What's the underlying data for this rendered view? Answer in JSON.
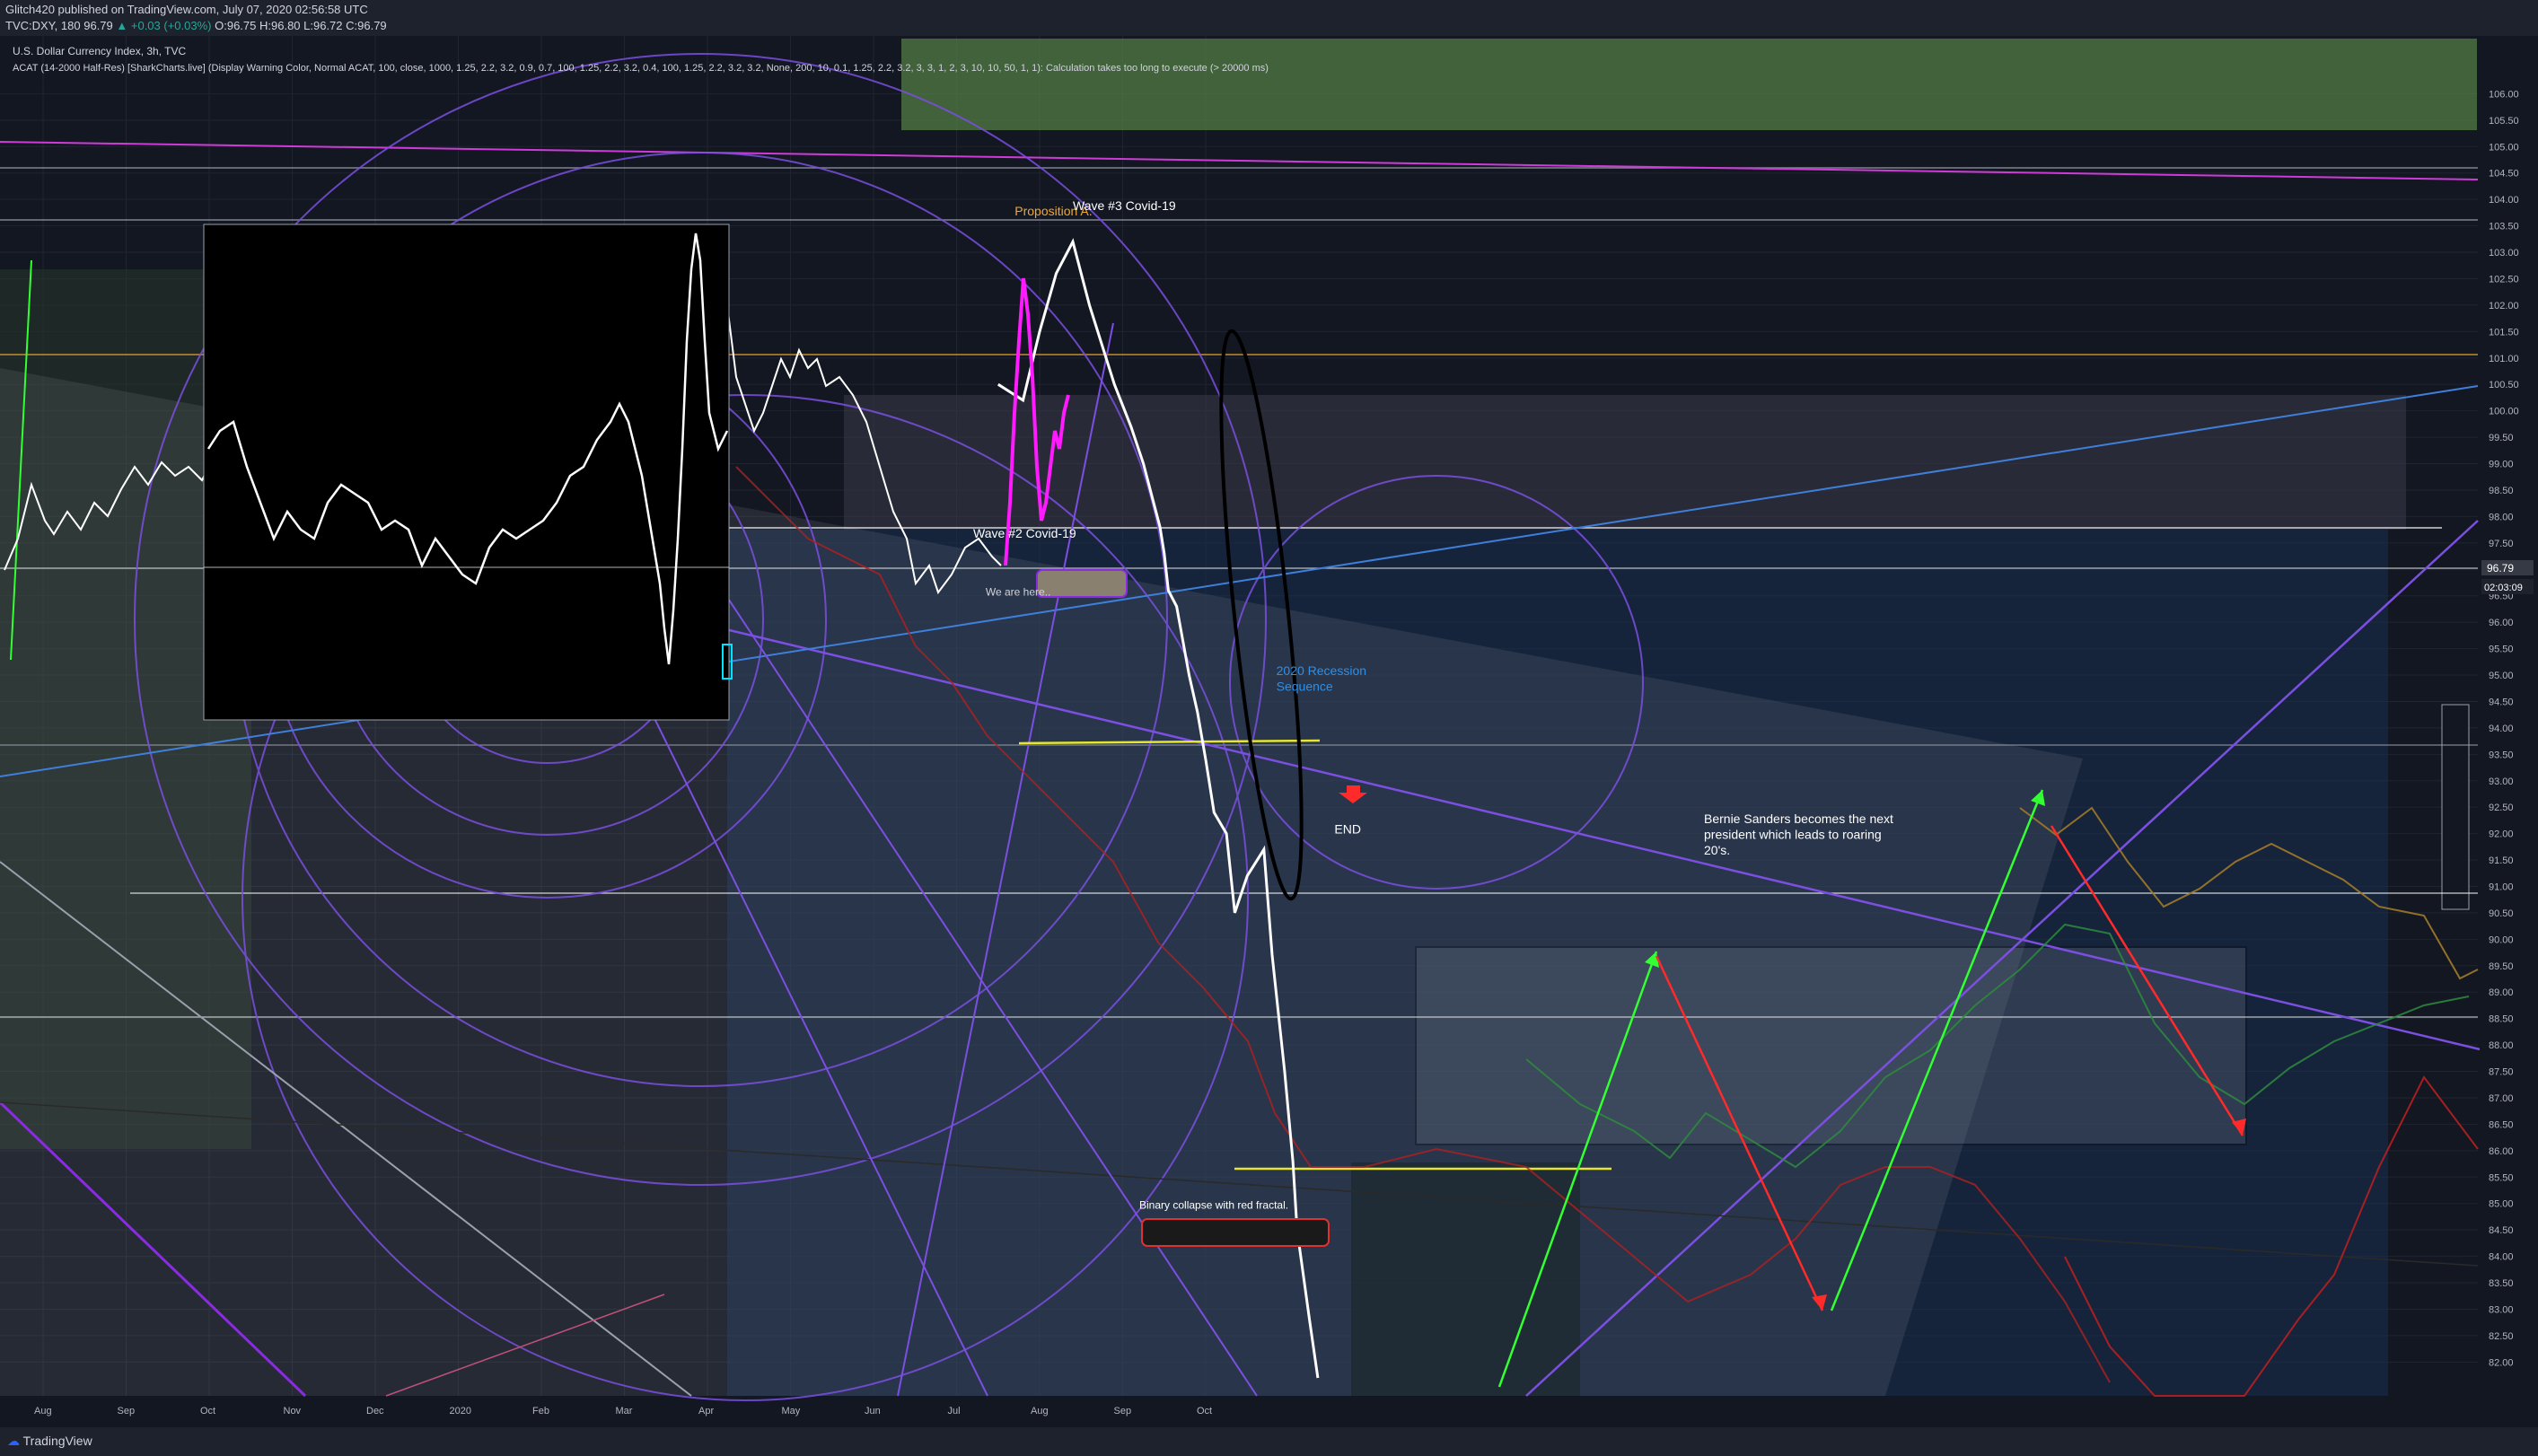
{
  "header": {
    "publisher": "Glitch420 published on TradingView.com, July 07, 2020 02:56:58 UTC",
    "symbol": "TVC:DXY, 180",
    "last": "96.79",
    "change": "▲ +0.03 (+0.03%)",
    "ohlc": "O:96.75 H:96.80 L:96.72 C:96.79"
  },
  "chart_title": "U.S. Dollar Currency Index, 3h, TVC",
  "indicator": "ACAT (14-2000 Half-Res) [SharkCharts.live] (Display Warning Color, Normal ACAT, 100, close, 1000, 1.25, 2.2, 3.2, 0.9, 0.7, 100, 1.25, 2.2, 3.2, 0.4, 100, 1.25, 2.2, 3.2, 3.2, None, 200, 10, 0.1, 1.25, 2.2, 3.2, 3, 3, 1, 2, 3, 10, 10, 50, 1, 1): Calculation takes too long to execute (> 20000 ms)",
  "footer": {
    "brand": "TradingView"
  },
  "price_badge": {
    "value": "96.79",
    "countdown": "02:03:09",
    "color": "#363a45"
  },
  "colors": {
    "background": "#131722",
    "price_line": "#ffffff",
    "magenta_fractal": "#ff1aff",
    "purple_lines": "#7b4fe0",
    "blue_line": "#3f7fd9",
    "yellow_line": "#e6e62e",
    "green_arrow": "#33ff33",
    "red_arrow": "#ff2a2a",
    "orange_text": "#f0a830",
    "blue_text": "#2f8fe8"
  },
  "chart_data": {
    "type": "line",
    "x_ticks": [
      "Aug",
      "Sep",
      "Oct",
      "Nov",
      "Dec",
      "2020",
      "Feb",
      "Mar",
      "Apr",
      "May",
      "Jun",
      "Jul",
      "Aug",
      "Sep",
      "Oct"
    ],
    "y_ticks": [
      "106.00",
      "105.50",
      "105.00",
      "104.50",
      "104.00",
      "103.50",
      "103.00",
      "102.50",
      "102.00",
      "101.50",
      "101.00",
      "100.50",
      "100.00",
      "99.50",
      "99.00",
      "98.50",
      "98.00",
      "97.50",
      "97.00",
      "96.50",
      "96.00",
      "95.50",
      "95.00",
      "94.50",
      "94.00",
      "93.50",
      "93.00",
      "92.50",
      "92.00",
      "91.50",
      "91.00",
      "90.50",
      "90.00",
      "89.50",
      "89.00",
      "88.50",
      "88.00",
      "87.50",
      "87.00",
      "86.50",
      "86.00",
      "85.50",
      "85.00",
      "84.50",
      "84.00",
      "83.50",
      "83.00",
      "82.50",
      "82.00"
    ],
    "ylim": [
      81.7,
      106.5
    ],
    "projection_series": [
      {
        "month": 11.5,
        "value": 100.5
      },
      {
        "month": 11.8,
        "value": 100.2
      },
      {
        "month": 12.0,
        "value": 101.5
      },
      {
        "month": 12.2,
        "value": 102.6
      },
      {
        "month": 12.4,
        "value": 103.2
      },
      {
        "month": 12.6,
        "value": 102.0
      },
      {
        "month": 12.9,
        "value": 100.5
      },
      {
        "month": 13.1,
        "value": 99.7
      },
      {
        "month": 13.25,
        "value": 99.0
      },
      {
        "month": 13.45,
        "value": 97.8
      },
      {
        "month": 13.5,
        "value": 97.3
      },
      {
        "month": 13.55,
        "value": 96.6
      },
      {
        "month": 13.65,
        "value": 96.3
      },
      {
        "month": 13.8,
        "value": 95.0
      },
      {
        "month": 13.9,
        "value": 94.3
      },
      {
        "month": 14.0,
        "value": 93.4
      },
      {
        "month": 14.1,
        "value": 92.4
      },
      {
        "month": 14.25,
        "value": 92.0
      },
      {
        "month": 14.35,
        "value": 90.5
      },
      {
        "month": 14.5,
        "value": 91.2
      },
      {
        "month": 14.7,
        "value": 91.7
      },
      {
        "month": 14.8,
        "value": 89.7
      },
      {
        "month": 14.95,
        "value": 87.5
      },
      {
        "month": 15.05,
        "value": 85.8
      },
      {
        "month": 15.1,
        "value": 84.5
      },
      {
        "month": 15.25,
        "value": 82.8
      },
      {
        "month": 15.35,
        "value": 81.7
      }
    ],
    "annotations": [
      {
        "id": "proposition",
        "text": "Proposition A.",
        "month": 11.7,
        "value": 103.7,
        "color": "#f0a830"
      },
      {
        "id": "wave3",
        "text": "Wave #3 Covid-19",
        "month": 12.4,
        "value": 103.8,
        "color": "#ffffff"
      },
      {
        "id": "wave2",
        "text": "Wave #2 Covid-19",
        "month": 11.2,
        "value": 97.6,
        "color": "#ffffff"
      },
      {
        "id": "here",
        "text": "We are here..",
        "month": 11.35,
        "value": 96.5,
        "color": "#d1d4dc"
      },
      {
        "id": "recession1",
        "text": "2020 Recession",
        "month": 14.85,
        "value": 95.0,
        "color": "#2f8fe8"
      },
      {
        "id": "recession2",
        "text": "Sequence",
        "month": 14.85,
        "value": 94.7,
        "color": "#2f8fe8"
      },
      {
        "id": "end",
        "text": "END",
        "month": 15.55,
        "value": 92.0,
        "color": "#ffffff"
      },
      {
        "id": "bernie1",
        "text": "Bernie Sanders becomes the next",
        "month": 20.0,
        "value": 92.2,
        "color": "#ffffff"
      },
      {
        "id": "bernie2",
        "text": "president which leads to roaring",
        "month": 20.0,
        "value": 91.9,
        "color": "#ffffff"
      },
      {
        "id": "bernie3",
        "text": "20's.",
        "month": 20.0,
        "value": 91.6,
        "color": "#ffffff"
      },
      {
        "id": "binary",
        "text": "Binary collapse with red fractal.",
        "month": 13.2,
        "value": 84.9,
        "color": "#ffffff"
      }
    ]
  }
}
